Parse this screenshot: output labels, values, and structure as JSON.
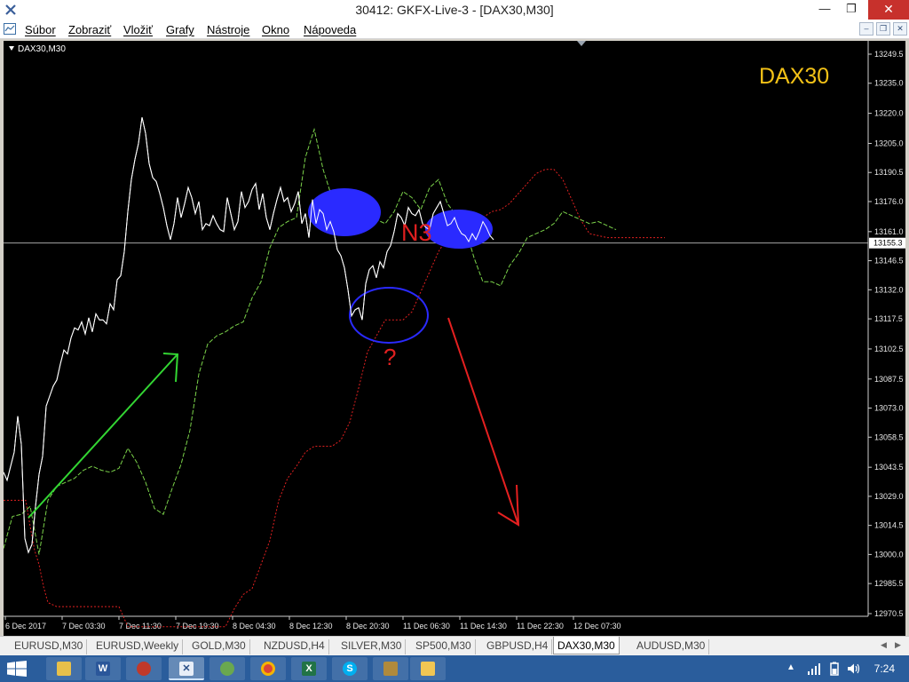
{
  "window": {
    "title": "30412: GKFX-Live-3 - [DAX30,M30]",
    "controls": {
      "minimize": "—",
      "maximize": "❐",
      "close": "✕"
    }
  },
  "menu": {
    "items": [
      "Súbor",
      "Zobraziť",
      "Vložiť",
      "Grafy",
      "Nástroje",
      "Okno",
      "Nápoveda"
    ]
  },
  "chart": {
    "label": "DAX30,M30",
    "annotation": "DAX30",
    "marker_n3": "N3",
    "marker_question": "?",
    "current_price_label": "13155.3",
    "colors": {
      "price": "#ffffff",
      "lagging": "#7bd34a",
      "senkou": "#e02020",
      "arrow_up": "#33d633",
      "arrow_down": "#e52020",
      "blue": "#2a2aff",
      "annotation": "#f3c217"
    }
  },
  "chart_data": {
    "type": "line",
    "y_ticks": [
      "13249.5",
      "13235.0",
      "13220.0",
      "13205.0",
      "13190.5",
      "13176.0",
      "13161.0",
      "13146.5",
      "13132.0",
      "13117.5",
      "13102.5",
      "13087.5",
      "13073.0",
      "13058.5",
      "13043.5",
      "13029.0",
      "13014.5",
      "13000.0",
      "12985.5",
      "12970.5"
    ],
    "ylim": [
      12970.5,
      13249.5
    ],
    "x_ticks": [
      "6 Dec 2017",
      "7 Dec 03:30",
      "7 Dec 11:30",
      "7 Dec 19:30",
      "8 Dec 04:30",
      "8 Dec 12:30",
      "8 Dec 20:30",
      "11 Dec 06:30",
      "11 Dec 14:30",
      "11 Dec 22:30",
      "12 Dec 07:30"
    ],
    "current_price": 13155.3,
    "series": [
      {
        "key": "price",
        "x": [
          0,
          4,
          8,
          12,
          16,
          20,
          24,
          28,
          32,
          36,
          40,
          44,
          48,
          52,
          56,
          60,
          64,
          68,
          72,
          76,
          80,
          84,
          88,
          92,
          96,
          100,
          104,
          108,
          112,
          116,
          120,
          124,
          128,
          132,
          136,
          140,
          144,
          148,
          152,
          156,
          160,
          164,
          168,
          172,
          176,
          180,
          184,
          188,
          192,
          196,
          200,
          204,
          208,
          212,
          216,
          220,
          224,
          228,
          232,
          236,
          240,
          244,
          248,
          252,
          256,
          260,
          264,
          268,
          272,
          276,
          280,
          284,
          288,
          292,
          296,
          300,
          304,
          308,
          312,
          316,
          320,
          324,
          328,
          332,
          336,
          340,
          344,
          348,
          352,
          356,
          360,
          364,
          368,
          372,
          376,
          380,
          384,
          388,
          392,
          396,
          400,
          404,
          408,
          412,
          416,
          420,
          424,
          428,
          432,
          436,
          440,
          444,
          448,
          452,
          456,
          460,
          464,
          468,
          472,
          476,
          480,
          484,
          488,
          492,
          496,
          500,
          504,
          508,
          512,
          516,
          520,
          524,
          528,
          532,
          536,
          540,
          544,
          548,
          552
        ],
        "y": [
          13041,
          13037,
          13044,
          13051,
          13069,
          13055,
          13008,
          13001,
          13005,
          13024,
          13040,
          13049,
          13074,
          13079,
          13084,
          13087,
          13095,
          13102,
          13100,
          13108,
          13113,
          13112,
          13116,
          13110,
          13118,
          13111,
          13120,
          13117,
          13117,
          13115,
          13125,
          13122,
          13137,
          13139,
          13151,
          13171,
          13187,
          13197,
          13205,
          13218,
          13210,
          13195,
          13188,
          13186,
          13180,
          13173,
          13164,
          13157,
          13165,
          13178,
          13168,
          13175,
          13183,
          13178,
          13170,
          13176,
          13162,
          13165,
          13164,
          13169,
          13165,
          13162,
          13161,
          13178,
          13170,
          13162,
          13166,
          13181,
          13173,
          13176,
          13182,
          13185,
          13172,
          13180,
          13168,
          13162,
          13170,
          13177,
          13183,
          13176,
          13178,
          13171,
          13175,
          13181,
          13165,
          13170,
          13158,
          13177,
          13165,
          13172,
          13170,
          13162,
          13166,
          13161,
          13152,
          13149,
          13143,
          13132,
          13119,
          13122,
          13123,
          13117,
          13135,
          13142,
          13144,
          13138,
          13146,
          13143,
          13151,
          13154,
          13161,
          13170,
          13168,
          13164,
          13173,
          13170,
          13169,
          13172,
          13165,
          13163,
          13162,
          13170,
          13173,
          13176,
          13170,
          13164,
          13165,
          13168,
          13163,
          13160,
          13159,
          13156,
          13160,
          13157,
          13161,
          13166,
          13163,
          13159,
          13157
        ]
      },
      {
        "key": "lagging",
        "x": [
          0,
          10,
          20,
          30,
          40,
          50,
          60,
          70,
          80,
          90,
          100,
          110,
          120,
          130,
          140,
          150,
          160,
          170,
          180,
          190,
          200,
          210,
          220,
          230,
          240,
          250,
          260,
          270,
          280,
          290,
          300,
          310,
          320,
          330,
          340,
          350,
          360,
          370,
          380,
          390,
          400,
          410,
          420,
          430,
          440,
          450,
          460,
          470,
          480,
          490,
          500,
          510,
          520,
          530,
          540,
          550,
          560,
          570,
          580,
          590,
          600,
          610,
          620,
          630,
          640,
          650,
          660,
          670,
          680,
          690
        ],
        "y": [
          13003,
          13019,
          13020,
          13024,
          13000,
          13027,
          13034,
          13036,
          13038,
          13042,
          13044,
          13042,
          13041,
          13043,
          13053,
          13046,
          13036,
          13023,
          13020,
          13033,
          13045,
          13062,
          13090,
          13105,
          13109,
          13111,
          13114,
          13116,
          13128,
          13136,
          13153,
          13163,
          13166,
          13168,
          13198,
          13212,
          13192,
          13178,
          13182,
          13177,
          13174,
          13170,
          13167,
          13165,
          13171,
          13181,
          13178,
          13172,
          13183,
          13187,
          13175,
          13169,
          13163,
          13148,
          13136,
          13136,
          13134,
          13144,
          13150,
          13158,
          13160,
          13162,
          13165,
          13171,
          13169,
          13167,
          13165,
          13166,
          13164,
          13162
        ]
      },
      {
        "key": "senkou",
        "x": [
          0,
          25,
          30,
          35,
          40,
          45,
          50,
          60,
          70,
          80,
          90,
          100,
          110,
          120,
          130,
          140,
          150,
          160,
          170,
          180,
          190,
          200,
          210,
          220,
          230,
          240,
          250,
          260,
          270,
          280,
          290,
          300,
          310,
          320,
          330,
          340,
          350,
          360,
          370,
          380,
          390,
          400,
          410,
          420,
          430,
          440,
          450,
          460,
          470,
          480,
          490,
          500,
          510,
          520,
          530,
          540,
          550,
          560,
          570,
          580,
          590,
          600,
          610,
          620,
          630,
          640,
          650,
          660,
          680,
          700,
          720,
          745
        ],
        "y": [
          13027,
          13027,
          13014,
          13002,
          12995,
          12984,
          12976,
          12974,
          12974,
          12974,
          12974,
          12974,
          12974,
          12974,
          12974,
          12964,
          12964,
          12964,
          12964,
          12964,
          12964,
          12964,
          12964,
          12964,
          12964,
          12964,
          12964,
          12973,
          12980,
          12983,
          12995,
          13007,
          13027,
          13038,
          13044,
          13051,
          13054,
          13054,
          13054,
          13057,
          13066,
          13083,
          13101,
          13109,
          13117,
          13117,
          13117,
          13121,
          13131,
          13141,
          13151,
          13158,
          13159,
          13162,
          13162,
          13168,
          13171,
          13172,
          13175,
          13180,
          13185,
          13190,
          13192,
          13192,
          13187,
          13177,
          13167,
          13160,
          13158,
          13158,
          13158,
          13158
        ]
      }
    ]
  },
  "tabs": {
    "items": [
      "EURUSD,M30",
      "EURUSD,Weekly",
      "GOLD,M30",
      "NZDUSD,H4",
      "SILVER,M30",
      "SP500,M30",
      "GBPUSD,H4",
      "DAX30,M30",
      "AUDUSD,M30"
    ],
    "active": "DAX30,M30"
  },
  "taskbar": {
    "apps": [
      "file-explorer-icon",
      "word-icon",
      "paint-icon",
      "metatrader-icon",
      "forex-app-icon",
      "chrome-icon",
      "excel-icon",
      "skype-icon",
      "photos-icon",
      "folder-icon"
    ],
    "clock": "7:24"
  }
}
